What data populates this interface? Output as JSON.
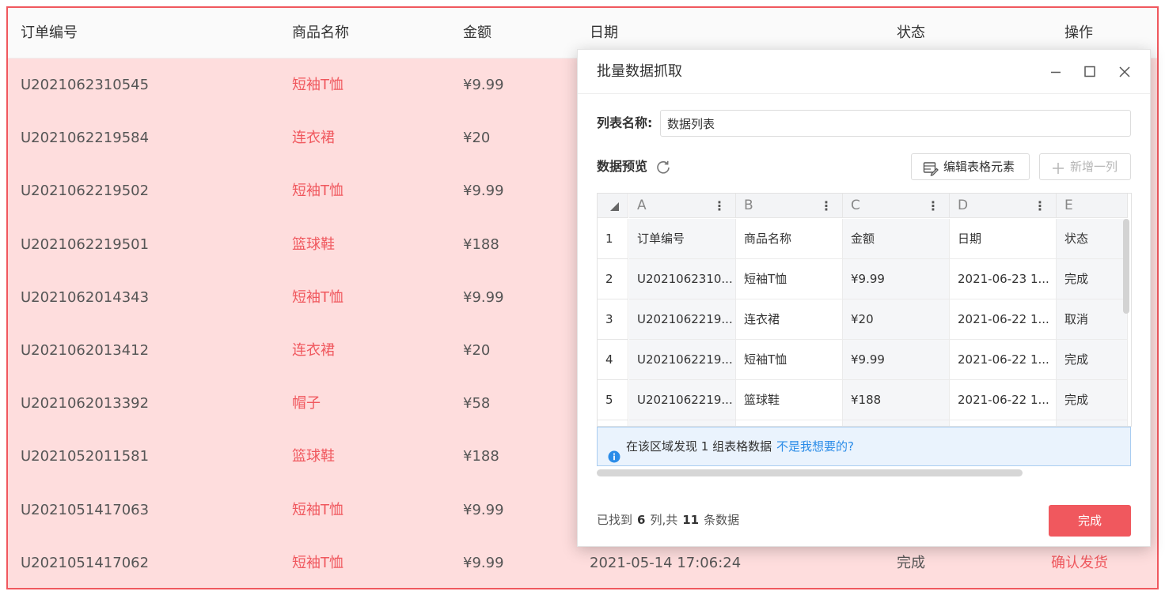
{
  "background_table": {
    "headers": [
      "订单编号",
      "商品名称",
      "金额",
      "日期",
      "状态",
      "操作"
    ],
    "rows": [
      {
        "order_id": "U2021062310545",
        "product": "短袖T恤",
        "amount": "¥9.99"
      },
      {
        "order_id": "U2021062219584",
        "product": "连衣裙",
        "amount": "¥20"
      },
      {
        "order_id": "U2021062219502",
        "product": "短袖T恤",
        "amount": "¥9.99"
      },
      {
        "order_id": "U2021062219501",
        "product": "篮球鞋",
        "amount": "¥188"
      },
      {
        "order_id": "U2021062014343",
        "product": "短袖T恤",
        "amount": "¥9.99"
      },
      {
        "order_id": "U2021062013412",
        "product": "连衣裙",
        "amount": "¥20"
      },
      {
        "order_id": "U2021062013392",
        "product": "帽子",
        "amount": "¥58"
      },
      {
        "order_id": "U2021052011581",
        "product": "篮球鞋",
        "amount": "¥188"
      },
      {
        "order_id": "U2021051417063",
        "product": "短袖T恤",
        "amount": "¥9.99"
      },
      {
        "order_id": "U2021051417062",
        "product": "短袖T恤",
        "amount": "¥9.99",
        "date": "2021-05-14 17:06:24",
        "status": "完成",
        "action": "确认发货"
      }
    ],
    "accent_color": "#f0585e",
    "highlight_bg": "#fedddd"
  },
  "dialog": {
    "title": "批量数据抓取",
    "window_icons": [
      "minimize-icon",
      "maximize-icon",
      "close-icon"
    ],
    "list_name_label": "列表名称:",
    "list_name_value": "数据列表",
    "preview_label": "数据预览",
    "edit_table_button": "编辑表格元素",
    "add_column_button": "新增一列",
    "grid": {
      "column_letters": [
        "A",
        "B",
        "C",
        "D",
        "E"
      ],
      "row_numbers": [
        "1",
        "2",
        "3",
        "4",
        "5"
      ],
      "rows": [
        [
          "订单编号",
          "商品名称",
          "金额",
          "日期",
          "状态"
        ],
        [
          "U2021062310...",
          "短袖T恤",
          "¥9.99",
          "2021-06-23 1...",
          "完成"
        ],
        [
          "U2021062219...",
          "连衣裙",
          "¥20",
          "2021-06-22 1...",
          "取消"
        ],
        [
          "U2021062219...",
          "短袖T恤",
          "¥9.99",
          "2021-06-22 1...",
          "完成"
        ],
        [
          "U2021062219...",
          "篮球鞋",
          "¥188",
          "2021-06-22 1...",
          "完成"
        ]
      ]
    },
    "notice_text": "在该区域发现 1 组表格数据",
    "notice_link": "不是我想要的?",
    "summary": {
      "prefix": "已找到",
      "columns": "6",
      "middle": "列,共",
      "rows": "11",
      "suffix": "条数据"
    },
    "done_button": "完成",
    "primary_color": "#f0585e",
    "link_color": "#2b8ce8"
  }
}
